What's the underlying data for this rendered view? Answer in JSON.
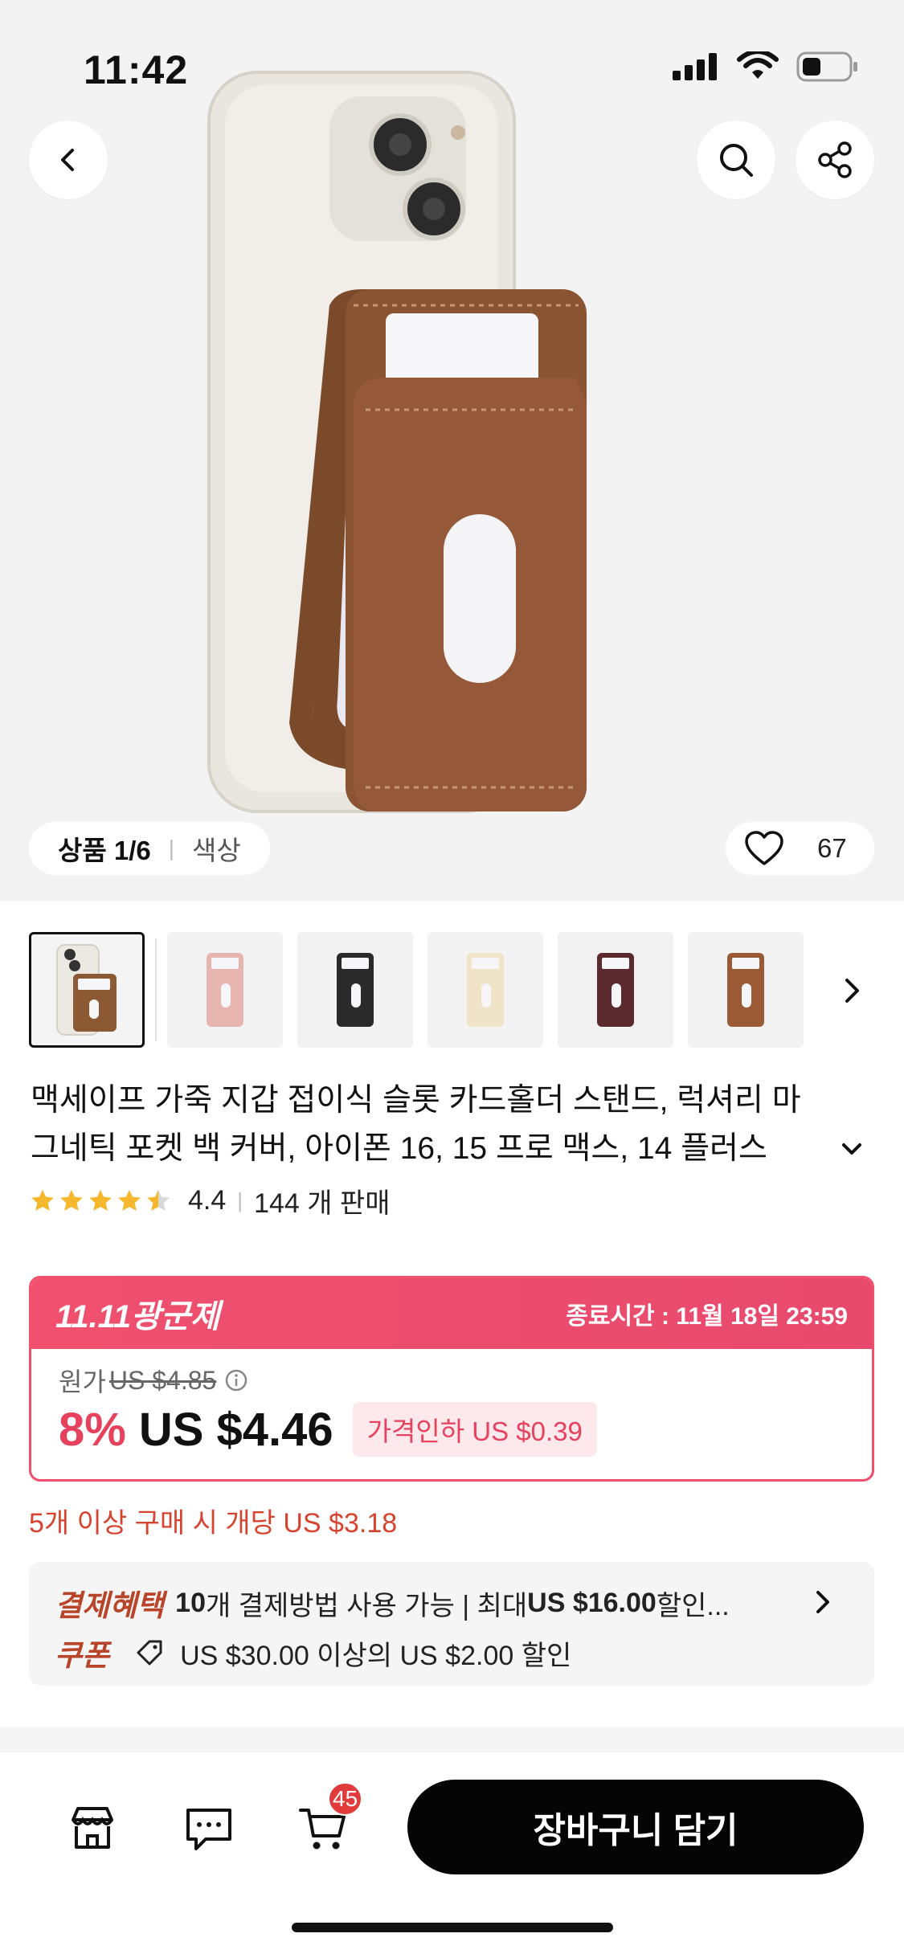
{
  "status": {
    "time": "11:42"
  },
  "hero": {
    "image_counter_label": "상품 1/6",
    "color_label": "색상",
    "likes": "67"
  },
  "thumbnails": [
    {
      "color": "#8b5a35",
      "active": true
    },
    {
      "color": "#e7b5b0",
      "active": false
    },
    {
      "color": "#2a2a2a",
      "active": false
    },
    {
      "color": "#efe4c8",
      "active": false
    },
    {
      "color": "#5a2a2f",
      "active": false
    },
    {
      "color": "#9a5a35",
      "active": false
    }
  ],
  "product": {
    "title_line1": "맥세이프 가죽 지갑 접이식 슬롯 카드홀더 스탠드, 럭셔리 마",
    "title_line2": "그네틱 포켓 백 커버, 아이폰 16, 15 프로 맥스, 14 플러스",
    "rating": "4.4",
    "sold": "144 개 판매"
  },
  "promo": {
    "event_name": "11.11광군제",
    "end_time": "종료시간 : 11월 18일 23:59",
    "original_label": "원가",
    "original_price": "US $4.85",
    "discount_percent": "8%",
    "price": "US $4.46",
    "price_drop": "가격인하 US $0.39",
    "bulk_offer": "5개 이상 구매 시 개당 US $3.18"
  },
  "benefits": {
    "payment_label": "결제혜택",
    "payment_count": "10",
    "payment_text": "개 결제방법 사용 가능 | 최대 ",
    "payment_max": "US $16.00",
    "payment_suffix": " 할인...",
    "coupon_label": "쿠폰",
    "coupon_text": "US $30.00 이상의 US $2.00 할인"
  },
  "bottom": {
    "cart_badge": "45",
    "add_to_cart": "장바구니 담기"
  },
  "colors": {
    "accent": "#f0506e",
    "benefit_label": "#b8452a",
    "star": "#f5b72b"
  }
}
